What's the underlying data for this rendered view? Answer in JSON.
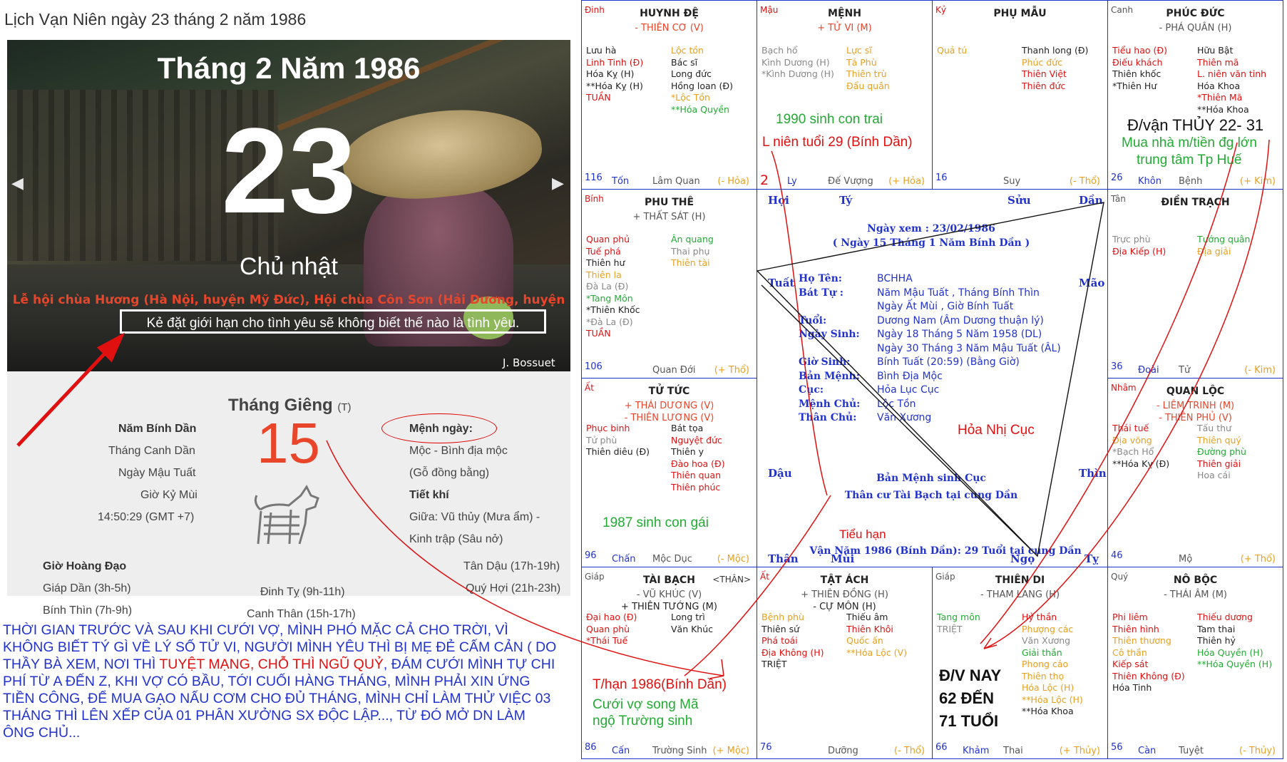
{
  "calendar": {
    "title": "Lịch Vạn Niên ngày 23 tháng 2 năm 1986",
    "month_year": "Tháng 2 Năm 1986",
    "day": "23",
    "weekday": "Chủ nhật",
    "festival": "Lễ hội chùa Hương (Hà Nội, huyện Mỹ Đức), Hội chùa Côn Sơn (Hải Dương, huyện",
    "quote": "Kẻ đặt giới hạn cho tình yêu sẽ không biết thế nào là tình yêu.",
    "quote_author": "J. Bossuet",
    "year_can_chi": "Năm Bính Dần",
    "month_can_chi": "Tháng Canh Dần",
    "day_can_chi": "Ngày Mậu Tuất",
    "hour_can_chi": "Giờ Kỷ Mùi",
    "time": "14:50:29 (GMT +7)",
    "lunar_month": "Tháng Giêng",
    "lunar_month_suffix": "(T)",
    "lunar_day": "15",
    "menh_label": "Mệnh ngày:",
    "menh_value": "Mộc - Bình địa mộc",
    "menh_sub": "(Gỗ đồng bằng)",
    "tiet_khi_label": "Tiết khí",
    "tiet_khi_1": "Giữa: Vũ thủy (Mưa ẩm) -",
    "tiet_khi_2": "Kinh trập (Sâu nở)",
    "gio_hoang_dao_label": "Giờ Hoàng Đạo",
    "gio": [
      "Giáp Dần (3h-5h)",
      "Bính Thìn (7h-9h)",
      "Đinh Tỵ (9h-11h)",
      "Canh Thân (15h-17h)",
      "Tân Dậu (17h-19h)",
      "Quý Hợi (21h-23h)"
    ],
    "arrow_prev": "◀",
    "arrow_next": "▶"
  },
  "story": {
    "part1": "THỜI GIAN TRƯỚC VÀ SAU KHI CƯỚI VỢ,  MÌNH PHÓ MẶC CẢ CHO TRỜI, VÌ KHÔNG BIẾT TÝ GÌ VỀ LÝ SỐ TỬ VI, NGƯỜI MÌNH YÊU THÌ BỊ MẸ ĐẺ CẤM CẢN ( DO THẦY BÀ XEM, NƠI THÌ ",
    "highlight": "TUYỆT MẠNG, CHỖ THÌ NGŨ QUỶ",
    "part2": ", ĐÁM CƯỚI MÌNH TỰ CHI PHÍ TỪ A ĐẾN Z, KHI VỢ CÓ BẦU, TỚI CUỐI HÀNG THÁNG, MÌNH PHẢI XIN ỨNG TIỀN CÔNG, ĐỂ MUA GẠO NẤU CƠM CHO ĐỦ THÁNG, MÌNH  CHỈ LÀM THỬ VIỆC 03 THÁNG THÌ LÊN XẾP CỦA 01 PHÂN XƯỞNG SX ĐỘC LẬP..., TỪ ĐÓ MỞ DN LÀM ÔNG CHỦ..."
  },
  "chart": {
    "cells": [
      {
        "id": "ty",
        "can": "Đinh",
        "name": "HUYNH ĐỆ",
        "main": "- THIÊN CƠ (V)",
        "c1": [
          [
            "k",
            "Lưu hà"
          ],
          [
            "r",
            "Linh Tinh (Đ)"
          ],
          [
            "k",
            "Hóa Kỵ (H)"
          ],
          [
            "k",
            "**Hóa Kỵ (H)"
          ],
          [
            "r",
            "TUẦN"
          ]
        ],
        "c2": [
          [
            "o",
            "Lộc tồn"
          ],
          [
            "k",
            "Bác sĩ"
          ],
          [
            "k",
            "Long đức"
          ],
          [
            "k",
            "Hồng loan (Đ)"
          ],
          [
            "o",
            "*Lộc Tồn"
          ],
          [
            "g",
            "**Hóa Quyền"
          ]
        ],
        "n": "116",
        "cung": "Tốn",
        "ts": "Lâm Quan",
        "ah": "(- Hỏa)"
      },
      {
        "id": "ngo",
        "can": "Mậu",
        "name": "MỆNH",
        "main": "+ TỬ VI (M)",
        "c1": [
          [
            "gr",
            "Bạch hổ"
          ],
          [
            "gr",
            "Kình Dương (H)"
          ],
          [
            "gr",
            "*Kình Dương (H)"
          ]
        ],
        "c2": [
          [
            "o",
            "Lực sĩ"
          ],
          [
            "o",
            "Tả Phù"
          ],
          [
            "o",
            "Thiên trù"
          ],
          [
            "o",
            "Đẩu quân"
          ]
        ],
        "n": "2",
        "cung": "Ly",
        "ts": "Đế Vượng",
        "ah": "(+ Hỏa)"
      },
      {
        "id": "mui",
        "can": "Kỷ",
        "name": "PHỤ MẪU",
        "main": "",
        "c1": [
          [
            "o",
            "Quả tú"
          ]
        ],
        "c2": [
          [
            "k",
            "Thanh long (Đ)"
          ],
          [
            "o",
            "Phúc đức"
          ],
          [
            "r",
            "Thiên Việt"
          ],
          [
            "r",
            "Thiên đức"
          ]
        ],
        "n": "16",
        "cung": "",
        "ts": "Suy",
        "ah": "(- Thổ)"
      },
      {
        "id": "than",
        "can": "Canh",
        "name": "PHÚC ĐỨC",
        "main": "- PHÁ QUÂN (H)",
        "c1": [
          [
            "r",
            "Tiểu hao (Đ)"
          ],
          [
            "r",
            "Điếu khách"
          ],
          [
            "k",
            "Thiên khốc"
          ],
          [
            "k",
            "*Thiên Hư"
          ]
        ],
        "c2": [
          [
            "k",
            "Hữu Bật"
          ],
          [
            "r",
            "Thiên mã"
          ],
          [
            "r",
            "L. niên văn tinh"
          ],
          [
            "k",
            "Hóa Khoa"
          ],
          [
            "r",
            "*Thiên Mã"
          ],
          [
            "k",
            "**Hóa Khoa"
          ]
        ],
        "n": "26",
        "cung": "Khôn",
        "ts": "Bệnh",
        "ah": "(+ Kim)"
      },
      {
        "id": "thin",
        "can": "Bính",
        "name": "PHU THÊ",
        "main": "+ THẤT SÁT (H)",
        "c1": [
          [
            "r",
            "Quan phủ"
          ],
          [
            "r",
            "Tuế phá"
          ],
          [
            "k",
            "Thiên hư"
          ],
          [
            "o",
            "Thiên la"
          ],
          [
            "gr",
            "Đà La (Đ)"
          ],
          [
            "g",
            "*Tang Môn"
          ],
          [
            "k",
            "*Thiên Khốc"
          ],
          [
            "gr",
            "*Đà La (Đ)"
          ],
          [
            "r",
            "TUẦN"
          ]
        ],
        "c2": [
          [
            "g",
            "Ân quang"
          ],
          [
            "gr",
            "Thai phụ"
          ],
          [
            "o",
            "Thiên tài"
          ]
        ],
        "n": "106",
        "cung": "",
        "ts": "Quan Đới",
        "ah": "(+ Thổ)"
      },
      {
        "id": "dau",
        "can": "Tân",
        "name": "ĐIỀN TRẠCH",
        "main": "",
        "c1": [
          [
            "gr",
            "Trực phù"
          ],
          [
            "r",
            "Địa Kiếp (H)"
          ]
        ],
        "c2": [
          [
            "g",
            "Tướng quân"
          ],
          [
            "o",
            "Địa giải"
          ]
        ],
        "n": "36",
        "cung": "Đoài",
        "ts": "Tử",
        "ah": "(- Kim)"
      },
      {
        "id": "mao",
        "can": "Ất",
        "name": "TỬ TỨC",
        "main": "+ THÁI DƯƠNG (V)|- THIÊN LƯƠNG (V)",
        "c1": [
          [
            "r",
            "Phục binh"
          ],
          [
            "gr",
            "Tử phù"
          ],
          [
            "k",
            "Thiên diêu (Đ)"
          ]
        ],
        "c2": [
          [
            "k",
            "Bát tọa"
          ],
          [
            "r",
            "Nguyệt đức"
          ],
          [
            "k",
            "Thiên y"
          ],
          [
            "r",
            "Đào hoa (Đ)"
          ],
          [
            "r",
            "Thiên quan"
          ],
          [
            "r",
            "Thiên phúc"
          ]
        ],
        "n": "96",
        "cung": "Chấn",
        "ts": "Mộc Dục",
        "ah": "(- Mộc)"
      },
      {
        "id": "tuat",
        "can": "Nhâm",
        "name": "QUAN LỘC",
        "main": "- LIÊM TRINH (M)|- THIÊN PHỦ (V)",
        "c1": [
          [
            "r",
            "Thái tuế"
          ],
          [
            "o",
            "Địa võng"
          ],
          [
            "gr",
            "*Bạch Hổ"
          ],
          [
            "k",
            "**Hóa Kỵ (Đ)"
          ]
        ],
        "c2": [
          [
            "gr",
            "Tấu thư"
          ],
          [
            "o",
            "Thiên quý"
          ],
          [
            "g",
            "Đường phù"
          ],
          [
            "r",
            "Thiên giải"
          ],
          [
            "gr",
            "Hoa cái"
          ]
        ],
        "n": "46",
        "cung": "",
        "ts": "Mộ",
        "ah": "(+ Thổ)"
      },
      {
        "id": "dan",
        "can": "Giáp",
        "name": "TÀI BẠCH",
        "than": "<THÂN>",
        "main": "- VŨ KHÚC (V)|+ THIÊN TƯỚNG (M)",
        "c1": [
          [
            "r",
            "Đại hao (Đ)"
          ],
          [
            "r",
            "Quan phù"
          ],
          [
            "r",
            "*Thái Tuế"
          ]
        ],
        "c2": [
          [
            "k",
            "Long trì"
          ],
          [
            "k",
            "Văn Khúc"
          ]
        ],
        "n": "86",
        "cung": "Cấn",
        "ts": "Trường Sinh",
        "ah": "(+ Mộc)"
      },
      {
        "id": "suu",
        "can": "Ất",
        "name": "TẬT ÁCH",
        "main": "+ THIÊN ĐỒNG (H)|- CỰ MÔN (H)",
        "c1": [
          [
            "o",
            "Bệnh phù"
          ],
          [
            "k",
            "Thiên sứ"
          ],
          [
            "r",
            "Phá toái"
          ],
          [
            "r",
            "Địa Không (H)"
          ],
          [
            "k",
            "TRIỆT"
          ]
        ],
        "c2": [
          [
            "k",
            "Thiếu âm"
          ],
          [
            "r",
            "Thiên Khôi"
          ],
          [
            "o",
            "Quốc ấn"
          ],
          [
            "o",
            "**Hóa Lộc (V)"
          ]
        ],
        "n": "76",
        "cung": "",
        "ts": "Dưỡng",
        "ah": "(- Thổ)"
      },
      {
        "id": "ty2",
        "can": "Giáp",
        "name": "THIÊN DI",
        "main": "- THAM LANG (H)",
        "c1": [
          [
            "g",
            "Tang môn"
          ],
          [
            "gr",
            "TRIỆT"
          ]
        ],
        "c2": [
          [
            "r",
            "Hỷ thần"
          ],
          [
            "o",
            "Phượng các"
          ],
          [
            "gr",
            "Văn Xương"
          ],
          [
            "g",
            "Giải thần"
          ],
          [
            "o",
            "Phong cáo"
          ],
          [
            "o",
            "Thiên thọ"
          ],
          [
            "o",
            "Hóa Lộc (H)"
          ],
          [
            "o",
            "**Hóa Lộc (H)"
          ],
          [
            "k",
            "**Hóa Khoa"
          ]
        ],
        "n": "66",
        "cung": "Khảm",
        "ts": "Thai",
        "ah": "(+ Thủy)"
      },
      {
        "id": "hoi",
        "can": "Quý",
        "name": "NÔ BỘC",
        "main": "- THÁI ÂM (M)",
        "c1": [
          [
            "r",
            "Phi liêm"
          ],
          [
            "r",
            "Thiên hình"
          ],
          [
            "o",
            "Thiên thương"
          ],
          [
            "o",
            "Cô thần"
          ],
          [
            "r",
            "Kiếp sát"
          ],
          [
            "r",
            "Thiên Không (Đ)"
          ],
          [
            "k",
            "Hóa Tinh"
          ]
        ],
        "c2": [
          [
            "r",
            "Thiếu dương"
          ],
          [
            "k",
            "Tam thai"
          ],
          [
            "k",
            "Thiên hỷ"
          ],
          [
            "g",
            "Hóa Quyền (H)"
          ],
          [
            "g",
            "**Hóa Quyền (H)"
          ]
        ],
        "n": "56",
        "cung": "Càn",
        "ts": "Tuyệt",
        "ah": "(- Thủy)"
      }
    ],
    "center": {
      "header1": "Ngày xem : 23/02/1986",
      "header2": "( Ngày 15 Tháng 1 Năm Bính Dần )",
      "rows": [
        {
          "label": "Họ Tên:",
          "value": "BCHHA"
        },
        {
          "label": "Bát Tự :",
          "value": "Năm Mậu Tuất , Tháng Bính Thìn"
        },
        {
          "label": "",
          "value": "Ngày Ất Mùi , Giờ Bính Tuất"
        },
        {
          "label": "Tuổi:",
          "value": "Dương Nam (Âm Dương thuận lý)"
        },
        {
          "label": "Ngày Sinh:",
          "value": "Ngày 18 Tháng 5 Năm 1958 (DL)"
        },
        {
          "label": "",
          "value": "Ngày 30 Tháng 3 Năm Mậu Tuất (ÂL)"
        },
        {
          "label": "Giờ Sinh:",
          "value": "Bính Tuất (20:59) (Bằng Giờ)"
        },
        {
          "label": "Bản Mệnh:",
          "value": "Bình Địa Mộc"
        },
        {
          "label": "Cục:",
          "value": "Hỏa Lục Cục"
        },
        {
          "label": "Mệnh Chủ:",
          "value": "Lộc Tồn"
        },
        {
          "label": "Thân Chủ:",
          "value": "Văn Xương"
        }
      ],
      "footer1": "Bản Mệnh sinh Cục",
      "footer2": "Thân cư Tài Bạch tại cung Dần",
      "cuc_note": "Hỏa Nhị Cục",
      "tieu_han": "Tiểu hạn",
      "van_nam": "Vận Năm 1986 (Bính Dần): 29 Tuổi tại cung Dần",
      "dirs": {
        "hoi": "Hợi",
        "ty": "Tý",
        "suu": "Sửu",
        "dan": "Dần",
        "tuat": "Tuất",
        "mao": "Mão",
        "dau": "Dậu",
        "thin": "Thìn",
        "than": "Thân",
        "mui": "Mùi",
        "ngo": "Ngọ",
        "ty2": "Tỵ"
      }
    },
    "notes": {
      "n1990": "1990 sinh con trai",
      "lnien": "L niên tuổi 29 (Bính Dần)",
      "dvan": "Đ/vận THỦY 22- 31",
      "muanha1": "Mua nhà m/tiền đg lớn",
      "muanha2": "trung tâm Tp Huế",
      "n1987": "1987 sinh con gái",
      "thhan": "T/hạn 1986(Bính Dần)",
      "cuoi1": "Cưới vợ song Mã",
      "cuoi2": "ngộ Trường sinh",
      "dvnay1": "Đ/V NAY",
      "dvnay2": "62 ĐẾN",
      "dvnay3": "71 TUỔI"
    }
  },
  "colors": {
    "chart_blue": "#2233cc",
    "red": "#e01010",
    "orange": "#e8a020",
    "green": "#22aa33"
  }
}
